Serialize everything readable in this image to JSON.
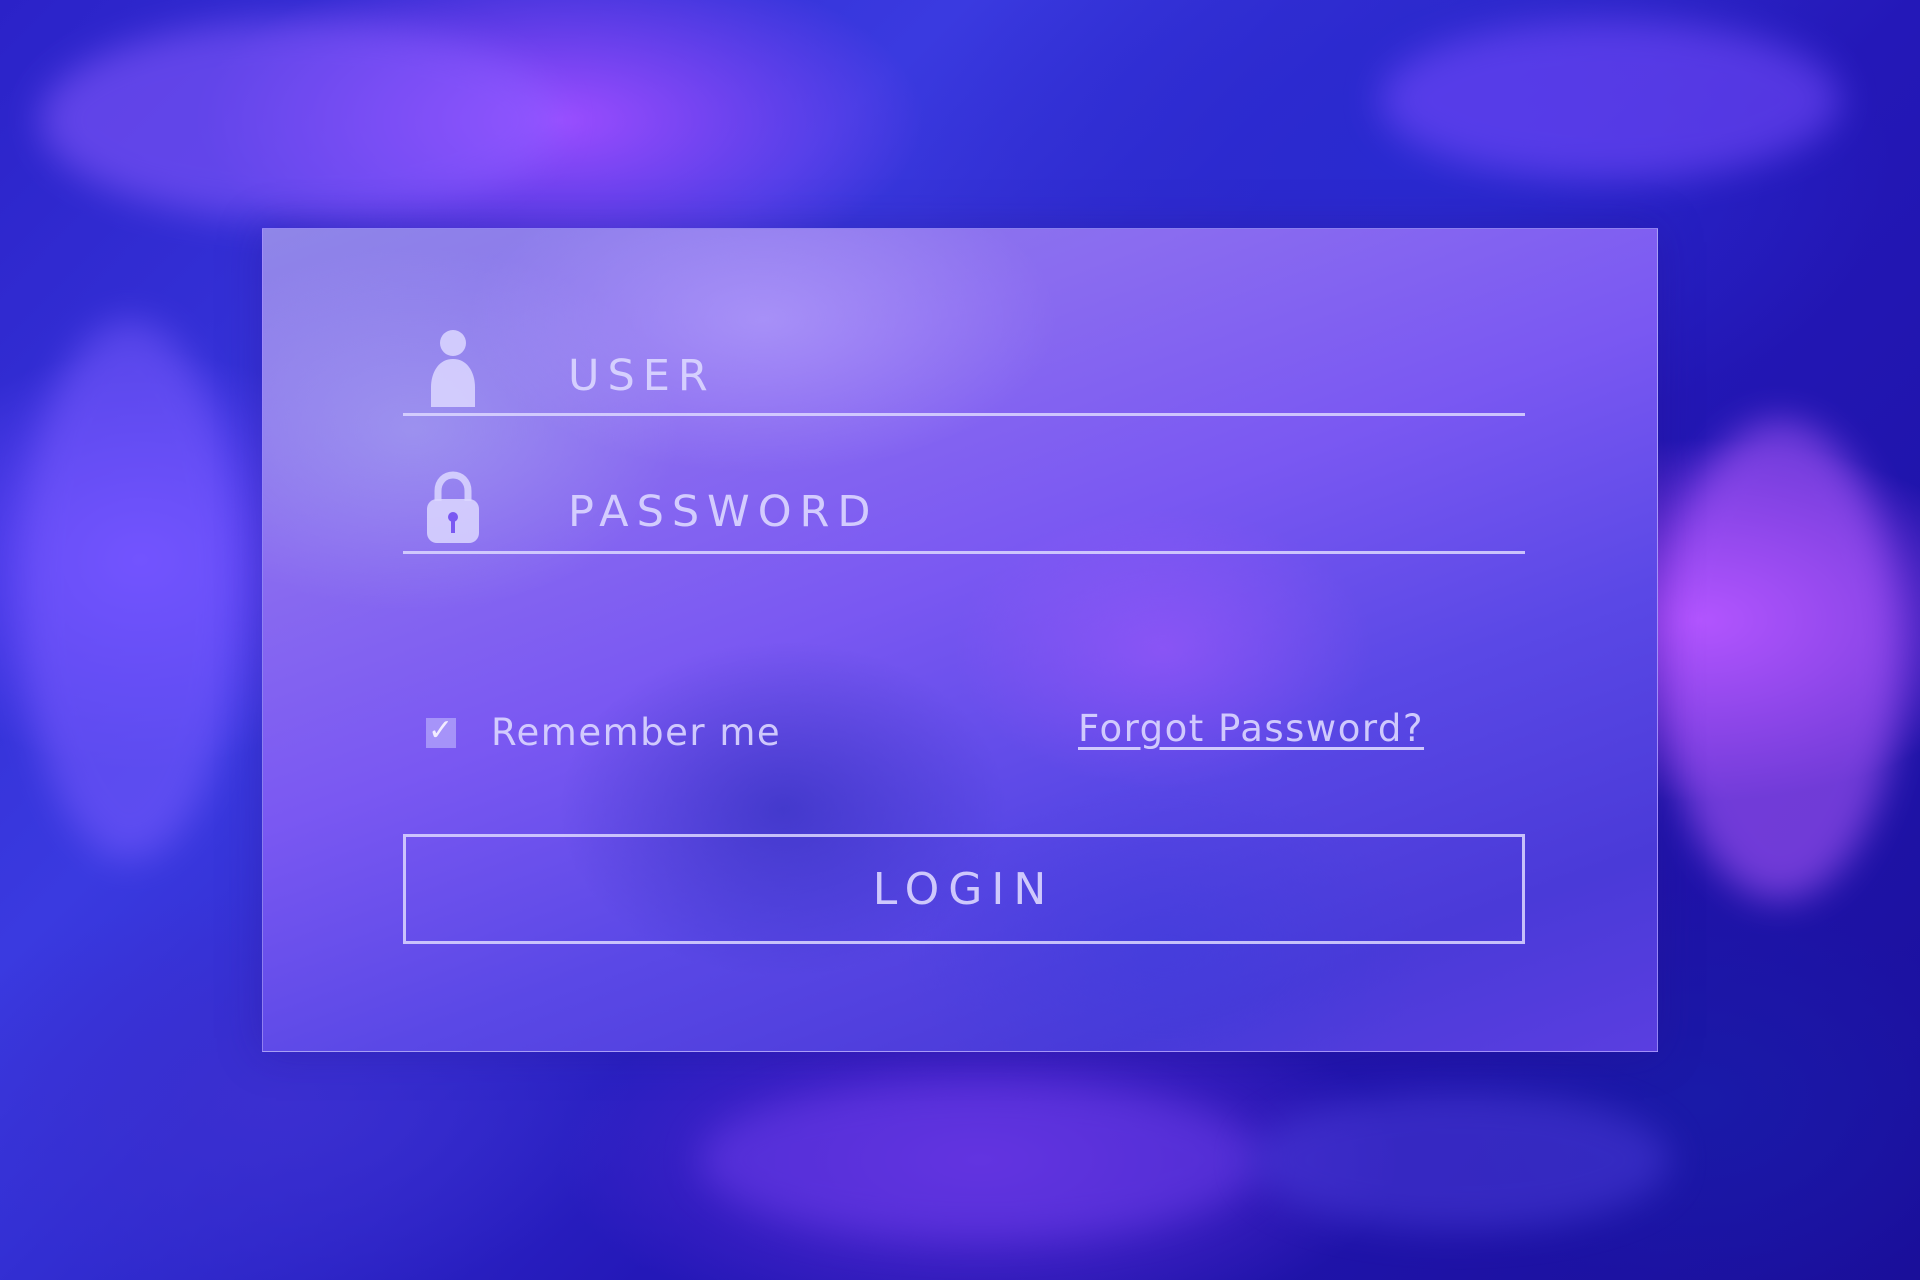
{
  "login_form": {
    "user": {
      "placeholder": "USER",
      "icon": "user-icon"
    },
    "password": {
      "placeholder": "PASSWORD",
      "icon": "lock-icon"
    },
    "remember": {
      "label": "Remember me",
      "checked": true
    },
    "forgot_link": "Forgot Password?",
    "submit_label": "LOGIN"
  },
  "colors": {
    "accent": "#dcd7ff",
    "background_deep": "#1a0f9a",
    "background_violet": "#9b4dff",
    "card_tint": "#7a58f2"
  }
}
